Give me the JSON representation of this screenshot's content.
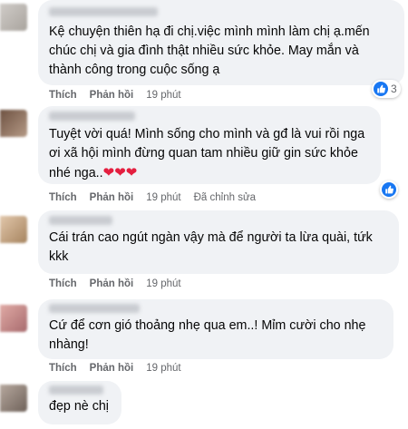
{
  "comments": [
    {
      "text": "Kệ chuyện thiên hạ đi chị.việc mình mình làm chị ạ.mến chúc chị và gia đình thật nhiều sức khỏe. May mắn và thành công trong cuộc sống ạ",
      "like": "Thích",
      "reply": "Phản hồi",
      "time": "19 phút",
      "reaction_icon": "like-icon",
      "reaction_count": "3",
      "avatar_color": "#b8b4b0"
    },
    {
      "text": "Tuyệt vời quá! Mình sống cho mình và gđ là vui rồi nga ơi xã hội mình đừng quan tam nhiều giữ gin sức khỏe nhé nga..",
      "hearts": "❤❤❤",
      "like": "Thích",
      "reply": "Phản hồi",
      "time": "19 phút",
      "edited": "Đã chỉnh sửa",
      "reaction_icon": "like-icon",
      "avatar_color": "#8a7060"
    },
    {
      "text": "Cái trán cao ngút ngàn vậy mà để người ta lừa quài, tứk kkk",
      "like": "Thích",
      "reply": "Phản hồi",
      "time": "19 phút",
      "avatar_color": "#c9a98c"
    },
    {
      "text": "Cứ để cơn gió thoảng nhẹ qua em..! Mỉm cười cho nhẹ nhàng!",
      "like": "Thích",
      "reply": "Phản hồi",
      "time": "19 phút",
      "avatar_color": "#c98f8f"
    },
    {
      "text": "đẹp nè chị",
      "avatar_color": "#9a8a80"
    }
  ]
}
